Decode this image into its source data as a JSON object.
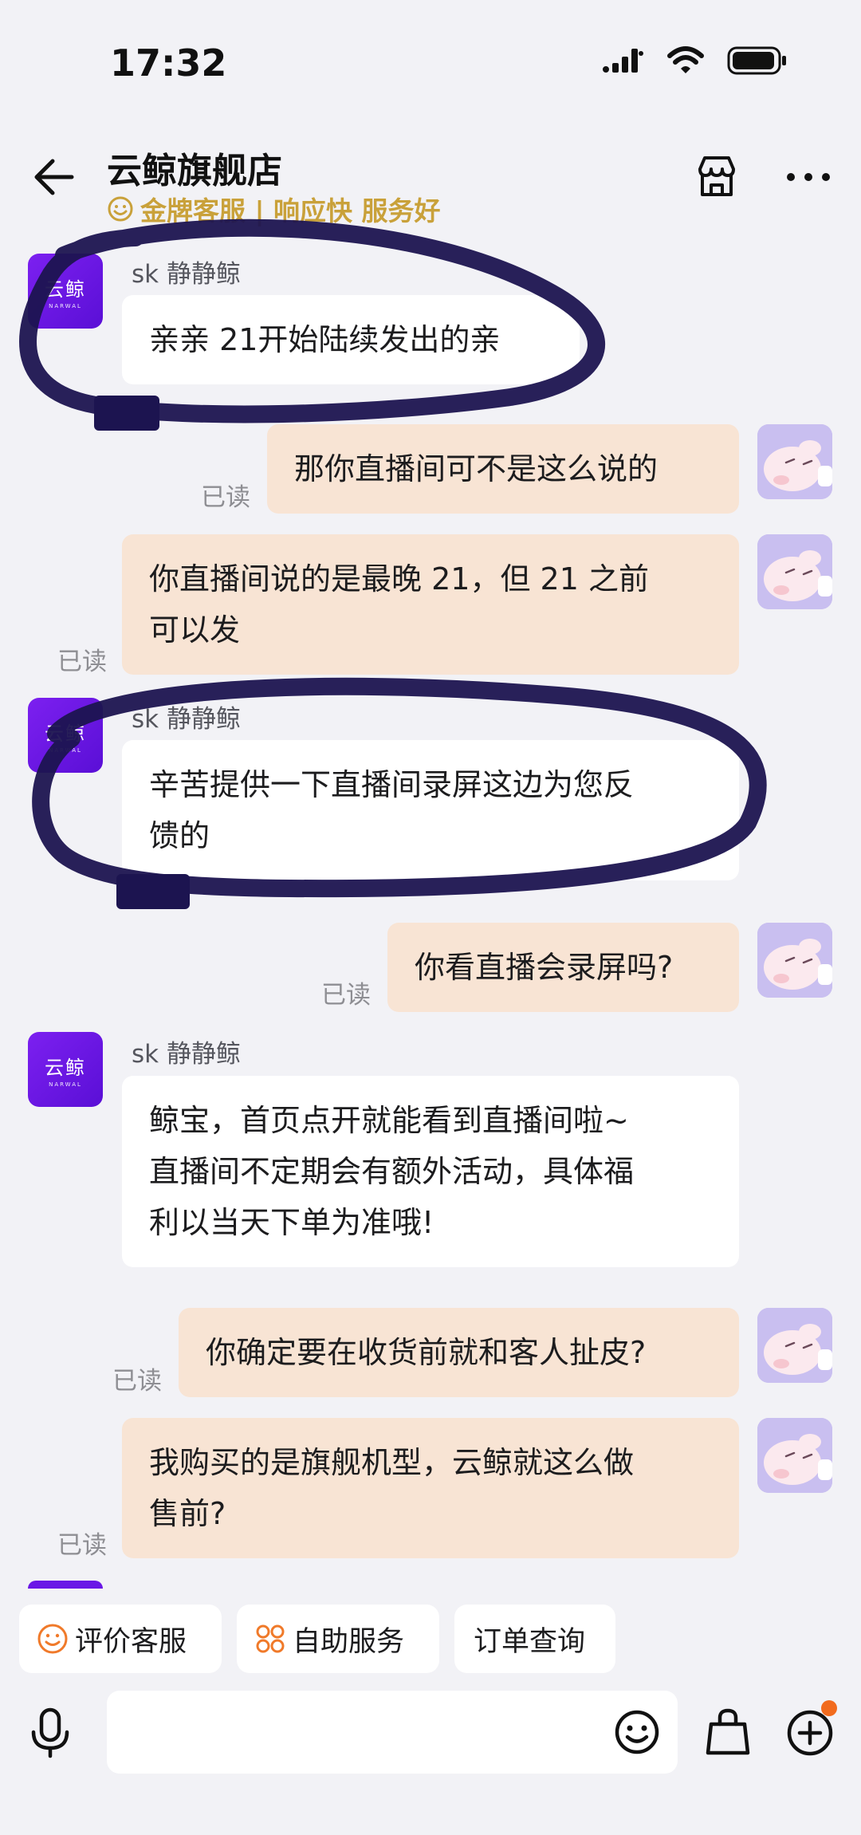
{
  "status_bar": {
    "time": "17:32"
  },
  "header": {
    "title": "云鲸旗舰店",
    "subtitle": "金牌客服 | 响应快 服务好",
    "accent_color": "#c9a13a"
  },
  "brand_avatar": {
    "name": "云鲸",
    "sub": "NARWAL"
  },
  "messages": [
    {
      "side": "in",
      "agent": "sk 静静鲸",
      "lines": [
        "亲亲 21开始陆续发出的亲"
      ]
    },
    {
      "side": "out",
      "read": "已读",
      "lines": [
        "那你直播间可不是这么说的"
      ]
    },
    {
      "side": "out",
      "read": "已读",
      "lines": [
        "你直播间说的是最晚 21，但 21 之前",
        "可以发"
      ]
    },
    {
      "side": "in",
      "agent": "sk 静静鲸",
      "lines": [
        "辛苦提供一下直播间录屏这边为您反",
        "馈的"
      ]
    },
    {
      "side": "out",
      "read": "已读",
      "lines": [
        "你看直播会录屏吗?"
      ]
    },
    {
      "side": "in",
      "agent": "sk 静静鲸",
      "lines": [
        "鲸宝，首页点开就能看到直播间啦~",
        "直播间不定期会有额外活动，具体福",
        "利以当天下单为准哦!"
      ]
    },
    {
      "side": "out",
      "read": "已读",
      "lines": [
        "你确定要在收货前就和客人扯皮?"
      ]
    },
    {
      "side": "out",
      "read": "已读",
      "lines": [
        "我购买的是旗舰机型，云鲸就这么做",
        "售前?"
      ]
    }
  ],
  "quick_actions": [
    {
      "label": "评价客服",
      "icon": "smile-icon"
    },
    {
      "label": "自助服务",
      "icon": "grid-icon"
    },
    {
      "label": "订单查询",
      "icon": ""
    }
  ],
  "colors": {
    "background": "#f2f2f6",
    "outgoing_bubble": "#f8e4d4",
    "incoming_bubble": "#ffffff",
    "brand_purple": "#6a17e6",
    "scribble": "#1c1450",
    "notification_dot": "#f26b1d"
  }
}
